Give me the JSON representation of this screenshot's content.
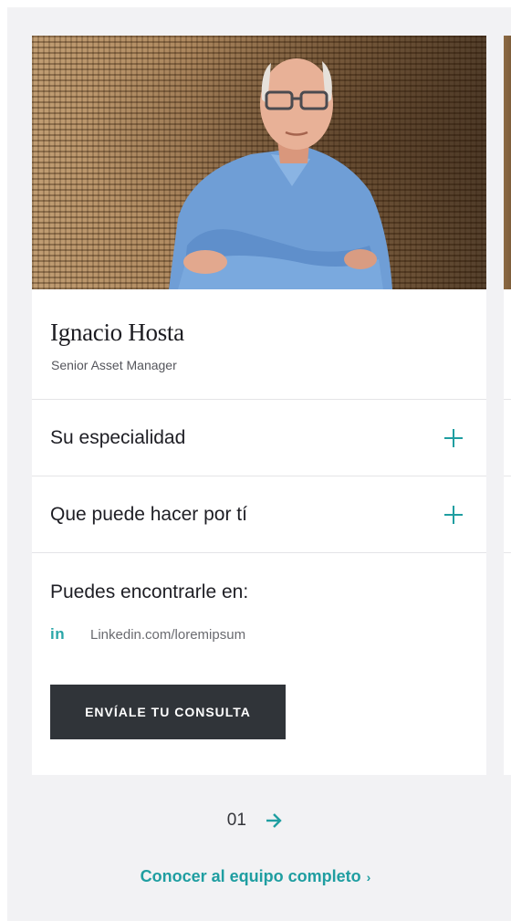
{
  "profile": {
    "name": "Ignacio Hosta",
    "role": "Senior Asset Manager"
  },
  "accordion": [
    {
      "label": "Su especialidad",
      "icon": "plus-icon"
    },
    {
      "label": "Que puede hacer por tí",
      "icon": "plus-icon"
    }
  ],
  "contact": {
    "heading": "Puedes encontrarle en:",
    "linkedin_icon_text": "in",
    "linkedin_url": "Linkedin.com/loremipsum"
  },
  "cta": {
    "label": "ENVÍALE TU CONSULTA"
  },
  "pager": {
    "current": "01",
    "next_icon": "arrow-right-icon"
  },
  "team_link": {
    "label": "Conocer al equipo completo",
    "chevron": "›"
  },
  "colors": {
    "accent": "#1f9ea1",
    "button_bg": "#303439",
    "panel_bg": "#f2f2f4"
  }
}
